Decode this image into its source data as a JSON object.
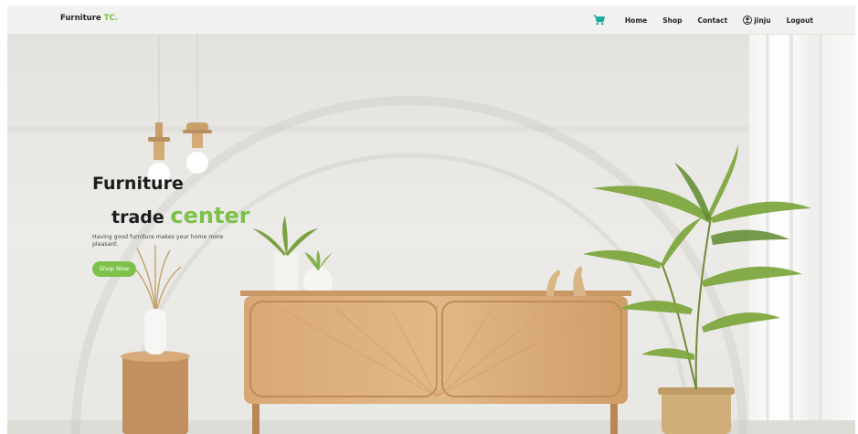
{
  "nav": {
    "brand": "Furniture",
    "brand_accent": "TC.",
    "links": {
      "home": "Home",
      "shop": "Shop",
      "contact": "Contact",
      "logout": "Logout"
    },
    "user": "jinju",
    "cart_icon": "cart-icon",
    "user_icon": "user-circle-icon"
  },
  "hero": {
    "title_line1": "Furniture",
    "title_line2_prefix": "trade",
    "title_line2_accent": "center",
    "tagline": "Having good furniture makes your home more pleasant.",
    "cta": "Shop Now"
  },
  "colors": {
    "accent": "#7cc14a",
    "cart": "#1aa89a",
    "text": "#1d1d1d"
  }
}
